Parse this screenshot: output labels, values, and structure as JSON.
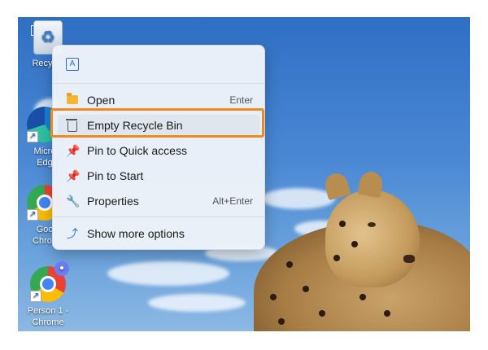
{
  "desktop": {
    "icons": [
      {
        "label": "Recycle",
        "kind": "recycle-bin"
      },
      {
        "label": "Micro\nEdg",
        "kind": "edge"
      },
      {
        "label": "Goo\nChron",
        "kind": "chrome"
      },
      {
        "label": "Person 1 -\nChrome",
        "kind": "chrome-profile"
      }
    ]
  },
  "context_menu": {
    "top_action_icon": "rename-icon",
    "items": [
      {
        "label": "Open",
        "shortcut": "Enter",
        "icon": "folder-icon"
      },
      {
        "label": "Empty Recycle Bin",
        "shortcut": "",
        "icon": "trash-icon",
        "highlighted": true
      },
      {
        "label": "Pin to Quick access",
        "shortcut": "",
        "icon": "pin-icon"
      },
      {
        "label": "Pin to Start",
        "shortcut": "",
        "icon": "pin-icon"
      },
      {
        "label": "Properties",
        "shortcut": "Alt+Enter",
        "icon": "wrench-icon"
      },
      {
        "label": "Show more options",
        "shortcut": "",
        "icon": "share-icon"
      }
    ]
  },
  "colors": {
    "highlight_border": "#f08a1c",
    "accent": "#2f6fd0"
  }
}
